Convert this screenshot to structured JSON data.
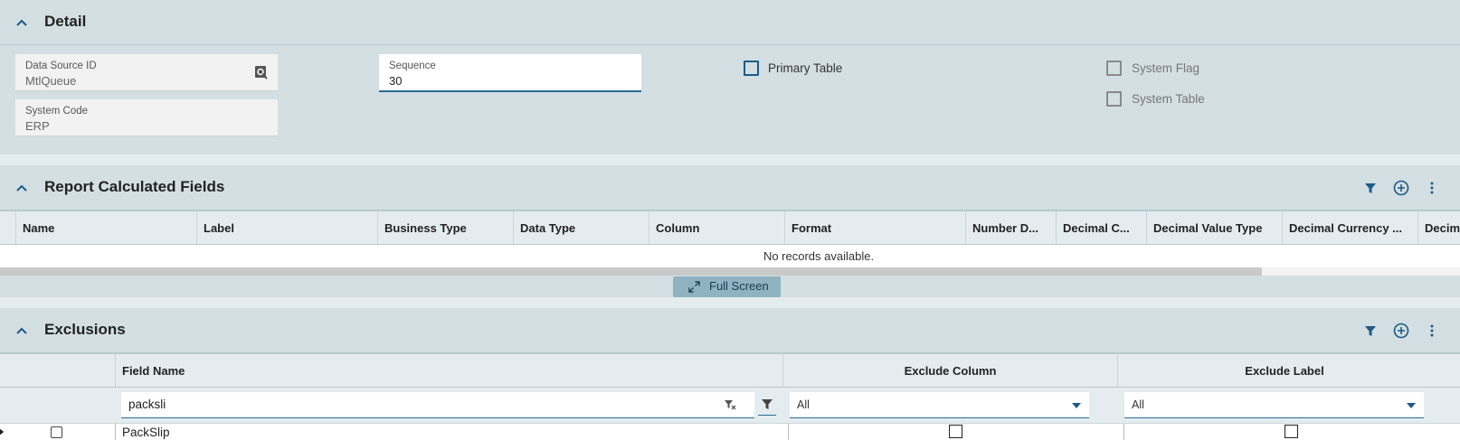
{
  "detail": {
    "title": "Detail",
    "data_source_id": {
      "label": "Data Source ID",
      "value": "MtlQueue"
    },
    "system_code": {
      "label": "System Code",
      "value": "ERP"
    },
    "sequence": {
      "label": "Sequence",
      "value": "30"
    },
    "primary_table": {
      "label": "Primary Table",
      "checked": false
    },
    "system_flag": {
      "label": "System Flag",
      "checked": false
    },
    "system_table": {
      "label": "System Table",
      "checked": false
    }
  },
  "calc_fields": {
    "title": "Report Calculated Fields",
    "columns": [
      "Name",
      "Label",
      "Business Type",
      "Data Type",
      "Column",
      "Format",
      "Number D...",
      "Decimal C...",
      "Decimal Value Type",
      "Decimal Currency ...",
      "Decim"
    ],
    "empty_message": "No records available.",
    "full_screen_label": "Full Screen"
  },
  "exclusions": {
    "title": "Exclusions",
    "columns": [
      "Field Name",
      "Exclude Column",
      "Exclude Label"
    ],
    "filter": {
      "field_name": "packsli",
      "exclude_column": "All",
      "exclude_label": "All"
    },
    "rows": [
      {
        "field_name": "PackSlip",
        "exclude_column": false,
        "exclude_label": false
      }
    ]
  },
  "colors": {
    "accent": "#1f5a85",
    "header_bg": "#d3dfe3"
  }
}
